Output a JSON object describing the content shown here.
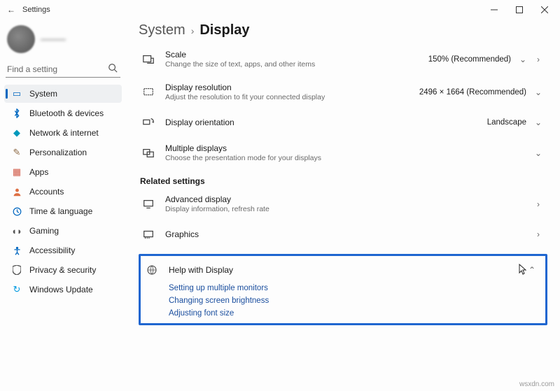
{
  "window": {
    "title": "Settings",
    "watermark": "wsxdn.com"
  },
  "sidebar": {
    "profile_name": "———",
    "search_placeholder": "Find a setting",
    "items": [
      {
        "label": "System"
      },
      {
        "label": "Bluetooth & devices"
      },
      {
        "label": "Network & internet"
      },
      {
        "label": "Personalization"
      },
      {
        "label": "Apps"
      },
      {
        "label": "Accounts"
      },
      {
        "label": "Time & language"
      },
      {
        "label": "Gaming"
      },
      {
        "label": "Accessibility"
      },
      {
        "label": "Privacy & security"
      },
      {
        "label": "Windows Update"
      }
    ]
  },
  "breadcrumb": {
    "parent": "System",
    "page": "Display"
  },
  "rows": {
    "scale": {
      "title": "Scale",
      "sub": "Change the size of text, apps, and other items",
      "value": "150% (Recommended)"
    },
    "res": {
      "title": "Display resolution",
      "sub": "Adjust the resolution to fit your connected display",
      "value": "2496 × 1664 (Recommended)"
    },
    "orient": {
      "title": "Display orientation",
      "value": "Landscape"
    },
    "multi": {
      "title": "Multiple displays",
      "sub": "Choose the presentation mode for your displays"
    },
    "adv": {
      "title": "Advanced display",
      "sub": "Display information, refresh rate"
    },
    "gfx": {
      "title": "Graphics"
    },
    "help": {
      "title": "Help with Display"
    }
  },
  "sections": {
    "related": "Related settings"
  },
  "help_links": [
    "Setting up multiple monitors",
    "Changing screen brightness",
    "Adjusting font size"
  ]
}
